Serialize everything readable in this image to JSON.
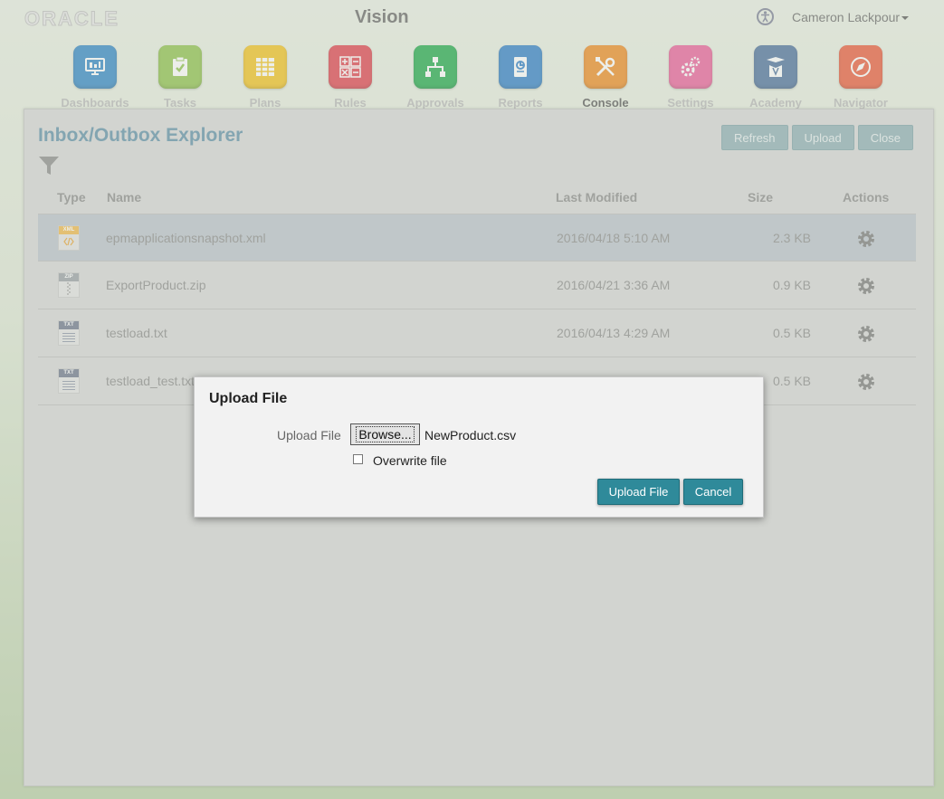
{
  "header": {
    "logo": "ORACLE",
    "app_title": "Vision",
    "user_name": "Cameron Lackpour"
  },
  "nav": [
    {
      "label": "Dashboards",
      "icon": "dashboards-icon",
      "color": "#2f86c6"
    },
    {
      "label": "Tasks",
      "icon": "tasks-icon",
      "color": "#8ec24a"
    },
    {
      "label": "Plans",
      "icon": "plans-icon",
      "color": "#f3c21d"
    },
    {
      "label": "Rules",
      "icon": "rules-icon",
      "color": "#e1404c"
    },
    {
      "label": "Approvals",
      "icon": "approvals-icon",
      "color": "#1faa4a"
    },
    {
      "label": "Reports",
      "icon": "reports-icon",
      "color": "#2e7fc8"
    },
    {
      "label": "Console",
      "icon": "console-icon",
      "color": "#ef8a20"
    },
    {
      "label": "Settings",
      "icon": "settings-icon",
      "color": "#ec5f9a"
    },
    {
      "label": "Academy",
      "icon": "academy-icon",
      "color": "#4a6f9c"
    },
    {
      "label": "Navigator",
      "icon": "navigator-icon",
      "color": "#ec5a3a"
    }
  ],
  "panel": {
    "title": "Inbox/Outbox Explorer",
    "buttons": {
      "refresh": "Refresh",
      "upload": "Upload",
      "close": "Close"
    },
    "columns": {
      "type": "Type",
      "name": "Name",
      "modified": "Last Modified",
      "size": "Size",
      "actions": "Actions"
    },
    "rows": [
      {
        "type": "XML",
        "name": "epmapplicationsnapshot.xml",
        "modified": "2016/04/18 5:10 AM",
        "size": "2.3 KB"
      },
      {
        "type": "ZIP",
        "name": "ExportProduct.zip",
        "modified": "2016/04/21 3:36 AM",
        "size": "0.9 KB"
      },
      {
        "type": "TXT",
        "name": "testload.txt",
        "modified": "2016/04/13 4:29 AM",
        "size": "0.5 KB"
      },
      {
        "type": "TXT",
        "name": "testload_test.txt",
        "modified": "",
        "size": "0.5 KB"
      }
    ]
  },
  "dialog": {
    "title": "Upload File",
    "file_label": "Upload File",
    "browse_label": "Browse...",
    "chosen_file": "NewProduct.csv",
    "overwrite_label": "Overwrite file",
    "upload_button": "Upload File",
    "cancel_button": "Cancel"
  }
}
